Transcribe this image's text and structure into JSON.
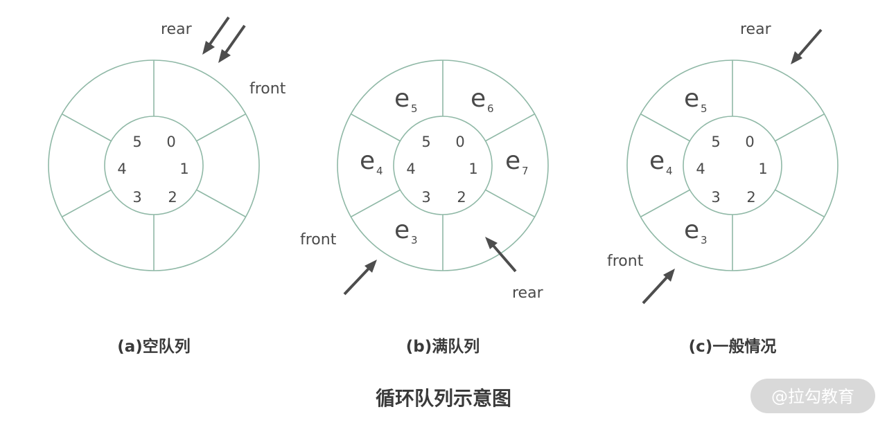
{
  "diagrams": [
    {
      "id": "a",
      "caption": "(a)空队列",
      "indices": [
        "0",
        "1",
        "2",
        "3",
        "4",
        "5"
      ],
      "elements": [],
      "pointers": {
        "rear": "rear",
        "front": "front"
      }
    },
    {
      "id": "b",
      "caption": "(b)满队列",
      "indices": [
        "0",
        "1",
        "2",
        "3",
        "4",
        "5"
      ],
      "elements": [
        {
          "slot": 0,
          "base": "e",
          "sub": "6"
        },
        {
          "slot": 1,
          "base": "e",
          "sub": "7"
        },
        {
          "slot": 3,
          "base": "e",
          "sub": "3"
        },
        {
          "slot": 4,
          "base": "e",
          "sub": "4"
        },
        {
          "slot": 5,
          "base": "e",
          "sub": "5"
        }
      ],
      "pointers": {
        "front": "front",
        "rear": "rear"
      }
    },
    {
      "id": "c",
      "caption": "(c)一般情况",
      "indices": [
        "0",
        "1",
        "2",
        "3",
        "4",
        "5"
      ],
      "elements": [
        {
          "slot": 3,
          "base": "e",
          "sub": "3"
        },
        {
          "slot": 4,
          "base": "e",
          "sub": "4"
        },
        {
          "slot": 5,
          "base": "e",
          "sub": "5"
        }
      ],
      "pointers": {
        "rear": "rear",
        "front": "front"
      }
    }
  ],
  "title": "循环队列示意图",
  "watermark": "@拉勾教育",
  "colors": {
    "ring": "#8fb8a6",
    "text": "#4a4a4a",
    "arrow": "#4d4d4d",
    "watermark_bg": "#d9d9d9"
  }
}
